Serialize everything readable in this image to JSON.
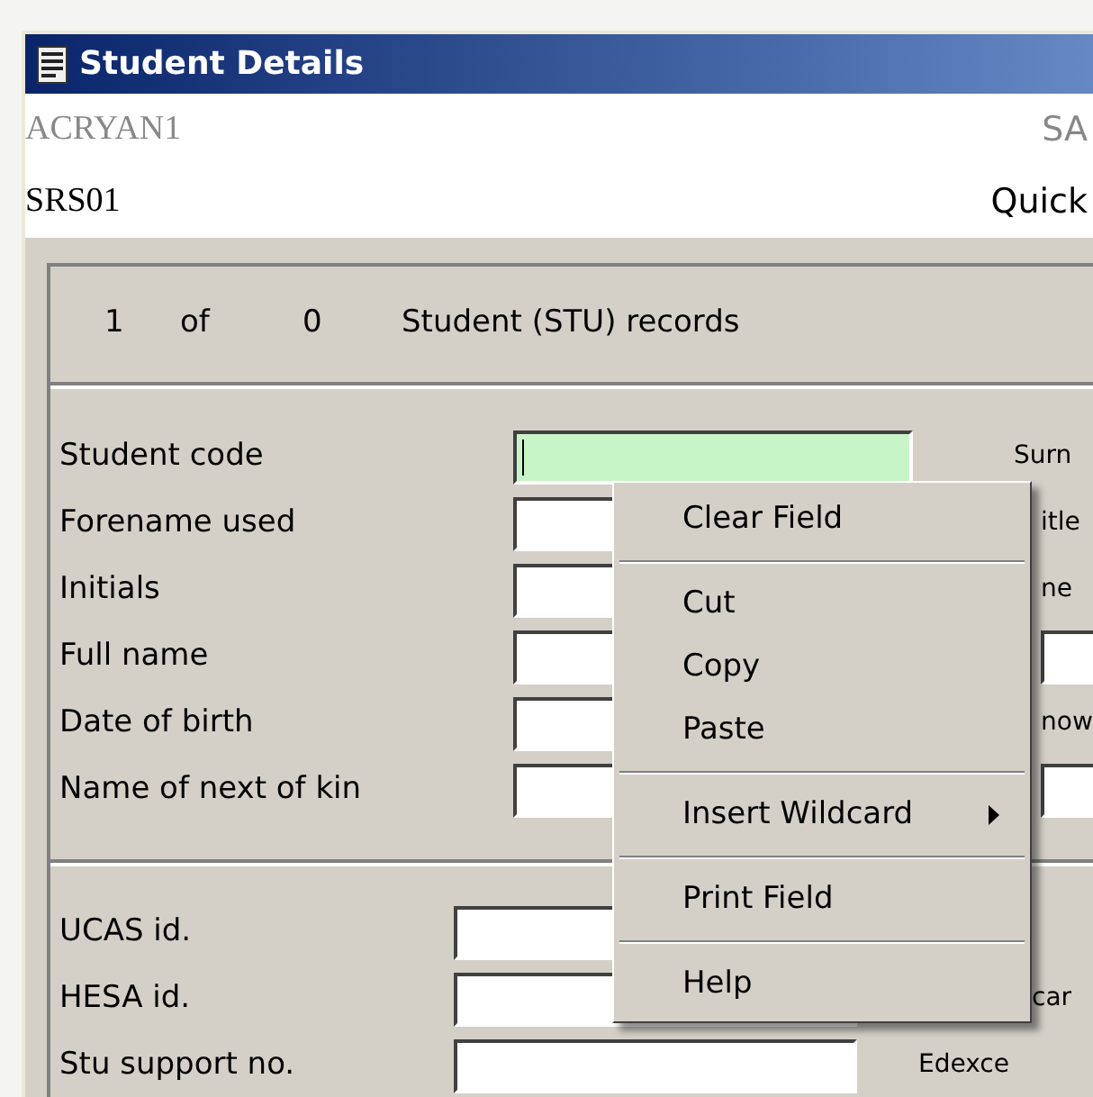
{
  "window": {
    "title": "Student Details"
  },
  "header": {
    "user": "ACRYAN1",
    "right_top": "SA",
    "system": "SRS01",
    "right_bottom": "Quick"
  },
  "record_counter": {
    "current": "1",
    "of": "of",
    "total": "0",
    "label": "Student (STU) records"
  },
  "fields_section_1": [
    {
      "label": "Student code",
      "focused": true,
      "side": {
        "kind": "label",
        "text": "Surn"
      }
    },
    {
      "label": "Forename used",
      "focused": false,
      "side": {
        "kind": "label",
        "text": "itle"
      }
    },
    {
      "label": "Initials",
      "focused": false,
      "side": {
        "kind": "label",
        "text": "ne"
      }
    },
    {
      "label": "Full name",
      "focused": false,
      "side": {
        "kind": "field"
      }
    },
    {
      "label": "Date of birth",
      "focused": false,
      "side": {
        "kind": "label",
        "text": "now"
      }
    },
    {
      "label": "Name of next of kin",
      "focused": false,
      "side": {
        "kind": "field"
      }
    }
  ],
  "fields_section_2": [
    {
      "label": "UCAS id.",
      "focused": false
    },
    {
      "label": "HESA id.",
      "focused": false,
      "side": {
        "kind": "label",
        "text": "car"
      }
    },
    {
      "label": "Stu support no.",
      "focused": false,
      "side": {
        "kind": "label",
        "text": "Edexce"
      }
    }
  ],
  "context_menu": {
    "items": [
      {
        "kind": "item",
        "label": "Clear Field"
      },
      {
        "kind": "separator"
      },
      {
        "kind": "item",
        "label": "Cut"
      },
      {
        "kind": "item",
        "label": "Copy"
      },
      {
        "kind": "item",
        "label": "Paste"
      },
      {
        "kind": "separator"
      },
      {
        "kind": "submenu",
        "label": "Insert Wildcard"
      },
      {
        "kind": "separator"
      },
      {
        "kind": "item",
        "label": "Print Field"
      },
      {
        "kind": "separator"
      },
      {
        "kind": "item",
        "label": "Help"
      }
    ]
  }
}
